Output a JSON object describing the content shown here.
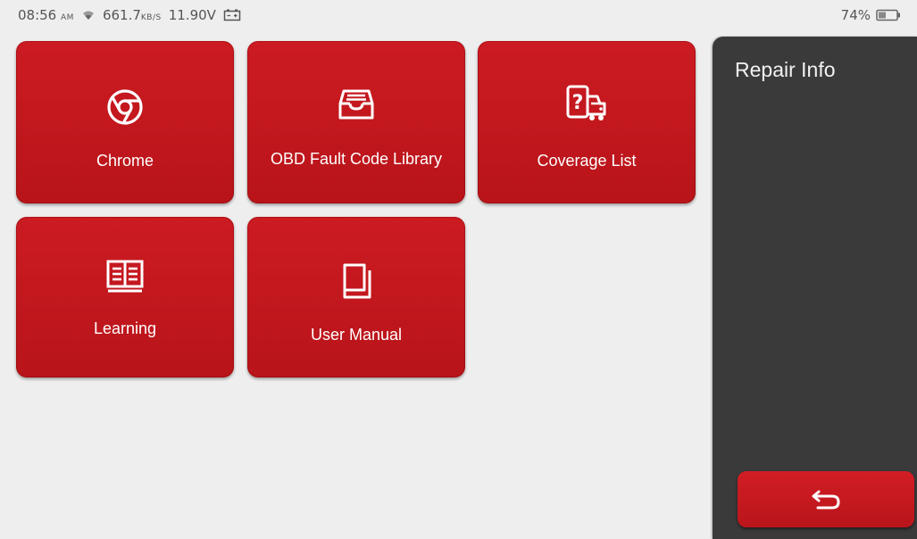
{
  "status_bar": {
    "time": "08:56",
    "time_suffix": "AM",
    "speed": "661.7",
    "speed_unit": "KB/S",
    "voltage": "11.90V",
    "battery_percent": "74%"
  },
  "tiles": [
    {
      "label": "Chrome",
      "icon": "chrome-icon"
    },
    {
      "label": "OBD Fault Code Library",
      "icon": "inbox-tray-icon"
    },
    {
      "label": "Coverage List",
      "icon": "car-question-icon"
    },
    {
      "label": "Learning",
      "icon": "open-book-icon"
    },
    {
      "label": "User Manual",
      "icon": "manual-book-icon"
    }
  ],
  "side_panel": {
    "title": "Repair Info",
    "back_icon": "back-arrow-icon"
  },
  "colors": {
    "tile_red": "#c3171e",
    "panel_dark": "#3a3a3a",
    "background": "#eeeeee"
  }
}
